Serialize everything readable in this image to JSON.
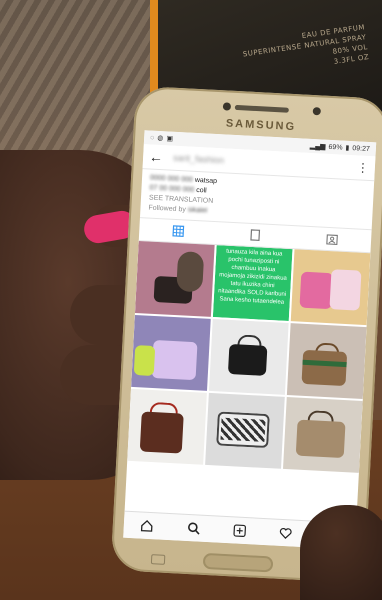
{
  "background": {
    "box_lines": [
      "EAU DE PARFUM",
      "SUPERINTENSE NATURAL SPRAY",
      "80% VOL",
      "3.3FL OZ"
    ]
  },
  "phone": {
    "brand": "SAMSUNG",
    "status": {
      "battery": "69%",
      "time": "09:27"
    },
    "profile": {
      "username": "sarit_fashion",
      "bio_line1_blur": "0000 000 000",
      "bio_line1_text": "watsap",
      "bio_line2_blur": "07 00 000 000",
      "bio_line2_text": "coll",
      "see_translation": "SEE TRANSLATION",
      "followed_by": "Followed by",
      "followed_by_blur": "sikalel"
    },
    "green_post_text": "tunauza kila aina kua pochi tunaziposti ni chambuu inakua mojamoja zikizidi zinakua tatu ikuzika chini nitaandika SOLD karibuni Sana kesho tutaendelea"
  },
  "colors": {
    "accent_green": "#29c36a",
    "nail": "#e0306a",
    "phone_gold": "#d8c9a6"
  },
  "icons": {
    "back": "back-arrow-icon",
    "menu": "kebab-menu-icon",
    "grid": "grid-icon",
    "feed": "feed-icon",
    "tagged": "tagged-icon",
    "home": "home-icon",
    "search": "search-icon",
    "add": "add-post-icon",
    "heart": "heart-icon",
    "profile": "profile-icon"
  }
}
